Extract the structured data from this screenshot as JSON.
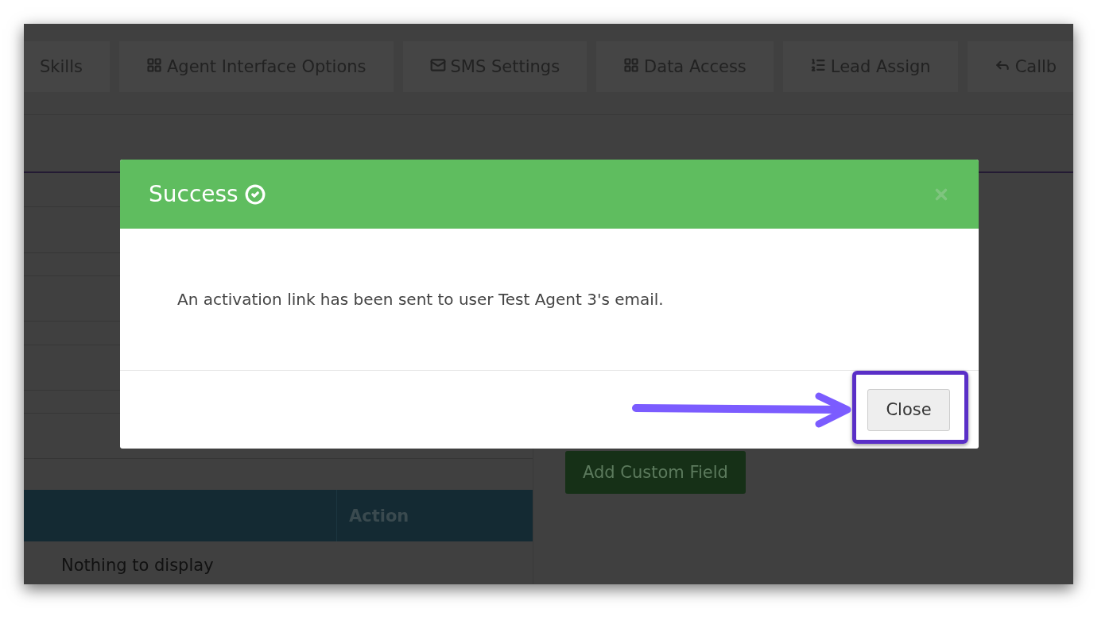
{
  "tabs": [
    {
      "label": "Skills"
    },
    {
      "label": "Agent Interface Options"
    },
    {
      "label": "SMS Settings"
    },
    {
      "label": "Data Access"
    },
    {
      "label": "Lead Assign"
    },
    {
      "label": "Callb"
    }
  ],
  "table": {
    "action_column": "Action",
    "empty_message": "Nothing to display"
  },
  "add_button": "Add Custom Field",
  "modal": {
    "title": "Success",
    "message": "An activation link has been sent to user Test Agent 3's email.",
    "close_button": "Close"
  }
}
